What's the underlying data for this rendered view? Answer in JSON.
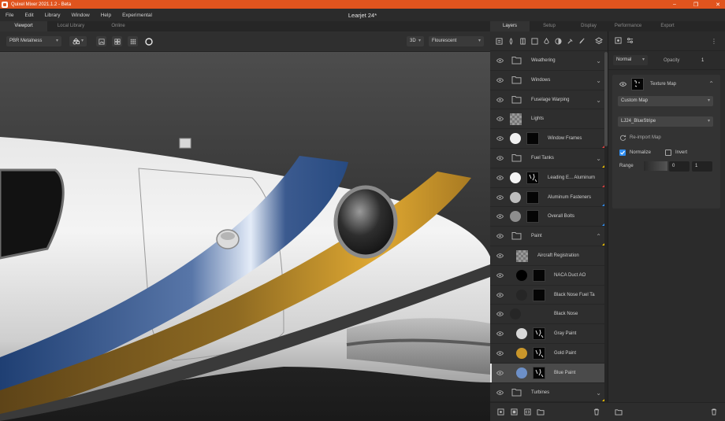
{
  "app": {
    "title": "Quixel Mixer 2021.1.2 - Beta",
    "document_title": "Learjet 24*",
    "accent": "#e0541e"
  },
  "window_controls": [
    "–",
    "❐",
    "✕"
  ],
  "menu": [
    "File",
    "Edit",
    "Library",
    "Window",
    "Help",
    "Experimental"
  ],
  "left_tabs": [
    "Viewport",
    "Local Library",
    "Online"
  ],
  "toolbar": {
    "material_mode": "PBR Metalness",
    "view_mode": "3D",
    "lighting": "Flourescent"
  },
  "right_tabs": [
    "Layers",
    "Setup",
    "Display",
    "Performance",
    "Export"
  ],
  "layers": [
    {
      "kind": "folder",
      "name": "Weathering",
      "expanded": false
    },
    {
      "kind": "folder",
      "name": "Windows",
      "expanded": false
    },
    {
      "kind": "folder",
      "name": "Fuselage Warping",
      "expanded": false
    },
    {
      "kind": "checker",
      "name": "Lights"
    },
    {
      "kind": "paint",
      "name": "Window Frames",
      "swatch": "#f0f0f0",
      "mask": "dark",
      "flag": "red"
    },
    {
      "kind": "folder",
      "name": "Fuel Tanks",
      "expanded": false,
      "flag": "yellow"
    },
    {
      "kind": "paint",
      "name": "Leading E... Aluminum",
      "swatch": "#f5f5f5",
      "mask": "white-specks",
      "flag": "red"
    },
    {
      "kind": "paint",
      "name": "Aluminum Fasteners",
      "swatch": "#bdbdbd",
      "mask": "dark",
      "flag": "blue"
    },
    {
      "kind": "paint",
      "name": "Overall Bolts",
      "swatch": "#8e8e8e",
      "mask": "dark",
      "flag": "blue"
    },
    {
      "kind": "folder",
      "name": "Paint",
      "expanded": true,
      "flag": "yellow"
    },
    {
      "kind": "checker-indent",
      "name": "Aircraft Registration"
    },
    {
      "kind": "paint",
      "name": "NACA Duct AO",
      "swatch": "#000000",
      "mask": "dark"
    },
    {
      "kind": "paint",
      "name": "Black Nose Fuel Ta",
      "swatch": "#262626",
      "mask": "dark"
    },
    {
      "kind": "swatch-only",
      "name": "Black Nose",
      "swatch": "#262626"
    },
    {
      "kind": "paint",
      "name": "Gray Paint",
      "swatch": "#d8d8d8",
      "mask": "white-specks"
    },
    {
      "kind": "paint",
      "name": "Gold Paint",
      "swatch": "#c9962a",
      "mask": "white-specks"
    },
    {
      "kind": "paint",
      "name": "Blue Paint",
      "swatch": "#6d90c8",
      "mask": "white-specks",
      "selected": true
    },
    {
      "kind": "folder",
      "name": "Turbines",
      "expanded": false,
      "flag": "yellow"
    }
  ],
  "properties": {
    "blend_mode": "Normal",
    "opacity_label": "Opacity",
    "opacity_value": "1",
    "card_title": "Texture Map",
    "map_type": "Custom Map",
    "map_name": "LJ24_BlueStripe",
    "reimport_label": "Re-import Map",
    "normalize_label": "Normalize",
    "normalize_checked": true,
    "invert_label": "Invert",
    "invert_checked": false,
    "range_label": "Range",
    "range_min": "0",
    "range_max": "1"
  }
}
